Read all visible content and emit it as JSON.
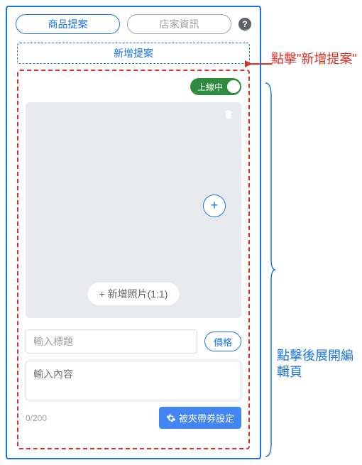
{
  "tabs": {
    "primary": "商品提案",
    "secondary": "店家資訊"
  },
  "help_glyph": "?",
  "add_proposal_label": "新增提案",
  "toggle_label": "上線中",
  "add_circle_glyph": "+",
  "add_photo_label": "+ 新增照片(1:1)",
  "title_placeholder": "輸入標題",
  "price_label": "價格",
  "content_placeholder": "輸入內容",
  "counter_text": "0/200",
  "coupon_label": "被夾帶券設定",
  "annotations": {
    "click_add": "點擊\"新增提案\"",
    "expand_editor": "點擊後展開編輯頁"
  },
  "colors": {
    "primary_blue": "#1a73e8",
    "danger_red": "#d93025",
    "toggle_green": "#2e8b3f",
    "gray_text": "#9aa0a6",
    "panel_gray": "#e8eaed",
    "button_blue": "#4285f4"
  }
}
